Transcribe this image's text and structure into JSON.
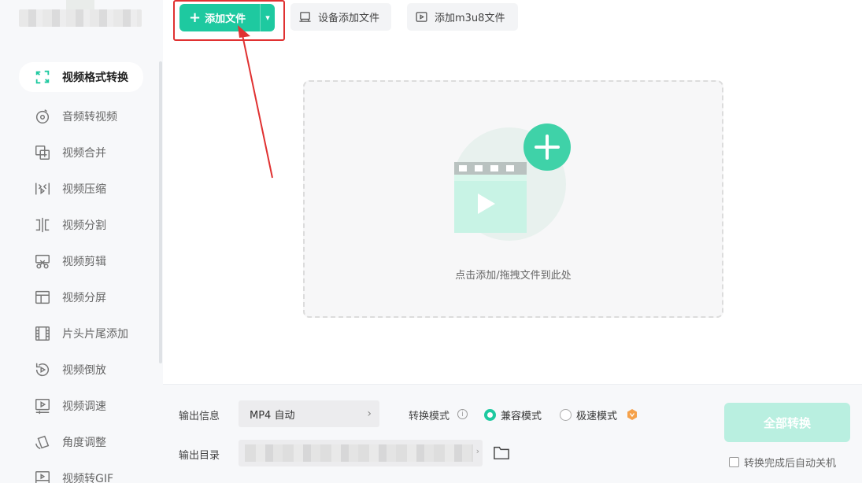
{
  "sidebar": {
    "items": [
      {
        "label": "视频格式转换",
        "icon": "video-convert-icon",
        "active": true
      },
      {
        "label": "音频转视频",
        "icon": "audio-to-video-icon"
      },
      {
        "label": "视频合并",
        "icon": "merge-icon"
      },
      {
        "label": "视频压缩",
        "icon": "compress-icon"
      },
      {
        "label": "视频分割",
        "icon": "split-icon"
      },
      {
        "label": "视频剪辑",
        "icon": "scissors-icon"
      },
      {
        "label": "视频分屏",
        "icon": "split-screen-icon"
      },
      {
        "label": "片头片尾添加",
        "icon": "film-strip-icon"
      },
      {
        "label": "视频倒放",
        "icon": "reverse-icon"
      },
      {
        "label": "视频调速",
        "icon": "speed-icon"
      },
      {
        "label": "角度调整",
        "icon": "rotate-icon"
      },
      {
        "label": "视频转GIF",
        "icon": "gif-icon"
      }
    ]
  },
  "toolbar": {
    "add_file": "添加文件",
    "device_add": "设备添加文件",
    "add_m3u8": "添加m3u8文件"
  },
  "dropzone": {
    "hint": "点击添加/拖拽文件到此处"
  },
  "bottom": {
    "output_info_label": "输出信息",
    "format_value": "MP4 自动",
    "output_dir_label": "输出目录",
    "mode_label": "转换模式",
    "mode_compatible": "兼容模式",
    "mode_fast": "极速模式",
    "convert_all": "全部转换",
    "auto_shutdown": "转换完成后自动关机"
  },
  "colors": {
    "accent": "#1ec9a0",
    "highlight": "#e03131"
  }
}
